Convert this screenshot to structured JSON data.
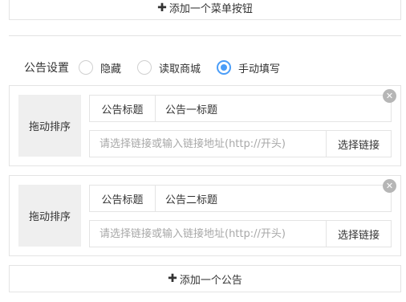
{
  "add_menu_button": {
    "icon": "plus-icon",
    "label": "添加一个菜单按钮"
  },
  "notice_setting": {
    "label": "公告设置",
    "options": [
      {
        "label": "隐藏",
        "checked": false
      },
      {
        "label": "读取商城",
        "checked": false
      },
      {
        "label": "手动填写",
        "checked": true
      }
    ]
  },
  "notices": [
    {
      "drag_label": "拖动排序",
      "title_label": "公告标题",
      "title_value": "公告一标题",
      "link_placeholder": "请选择链接或输入链接地址(http://开头)",
      "link_value": "",
      "link_button": "选择链接",
      "close_icon": "close-icon"
    },
    {
      "drag_label": "拖动排序",
      "title_label": "公告标题",
      "title_value": "公告二标题",
      "link_placeholder": "请选择链接或输入链接地址(http://开头)",
      "link_value": "",
      "link_button": "选择链接",
      "close_icon": "close-icon"
    }
  ],
  "add_notice_button": {
    "icon": "plus-icon",
    "label": "添加一个公告"
  },
  "colors": {
    "accent": "#4a9df8",
    "border": "#e4e4e4",
    "drag_bg": "#efefef",
    "close_bg": "#b6b6b6"
  }
}
